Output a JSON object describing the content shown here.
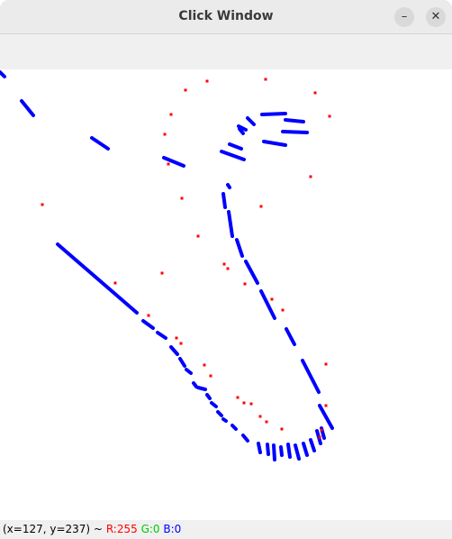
{
  "window": {
    "title": "Click Window",
    "minimize_glyph": "–",
    "close_glyph": "✕"
  },
  "status": {
    "coords": "(x=127, y=237) ~",
    "r": "R:255",
    "g": "G:0",
    "b": "B:0"
  },
  "colors": {
    "stroke": "#0000ff",
    "point": "#ff0000"
  }
}
